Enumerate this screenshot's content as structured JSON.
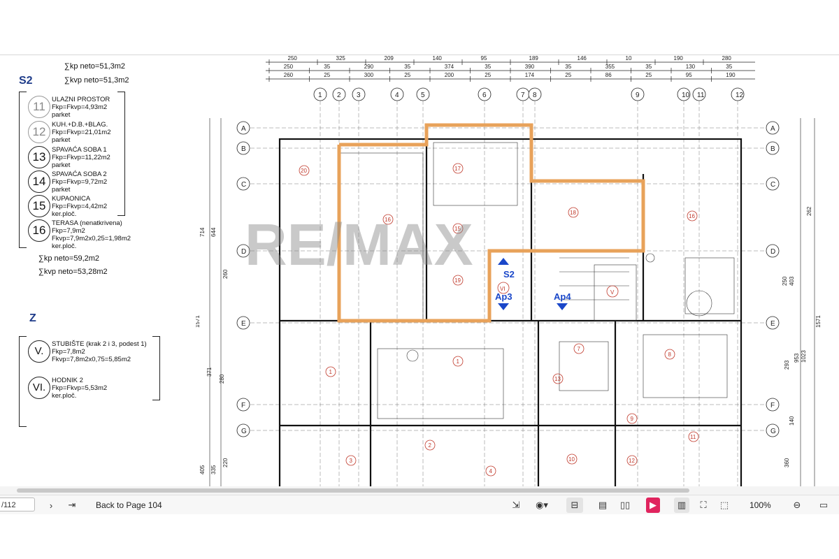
{
  "legend": {
    "sum_top_1": "∑kp neto=51,3m2",
    "sum_top_2": "∑kvp neto=51,3m2",
    "section_s2": "S2",
    "rooms": [
      {
        "num": "11",
        "name": "ULAZNI PROSTOR",
        "area": "Fkp=Fkvp=4,93m2",
        "floor": "parket"
      },
      {
        "num": "12",
        "name": "KUH.+D.B.+BLAG.",
        "area": "Fkp=Fkvp=21,01m2",
        "floor": "parket"
      },
      {
        "num": "13",
        "name": "SPAVAĆA SOBA 1",
        "area": "Fkp=Fkvp=11,22m2",
        "floor": "parket"
      },
      {
        "num": "14",
        "name": "SPAVAĆA SOBA 2",
        "area": "Fkp=Fkvp=9,72m2",
        "floor": "parket"
      },
      {
        "num": "15",
        "name": "KUPAONICA",
        "area": "Fkp=Fkvp=4,42m2",
        "floor": "ker.ploč."
      },
      {
        "num": "16",
        "name": "TERASA  (nenatkrivena)",
        "area": "Fkp=7,9m2",
        "floor": "Fkvp=7,9m2x0,25=1,98m2"
      }
    ],
    "room16_floor2": "ker.ploč.",
    "sum_mid_1": "∑kp neto=59,2m2",
    "sum_mid_2": "∑kvp neto=53,28m2",
    "section_z": "Z",
    "z_rooms": [
      {
        "num": "V.",
        "name": "STUBIŠTE (krak 2 i 3, podest 1)",
        "area": "Fkp=7,8m2",
        "floor": "Fkvp=7,8m2x0,75=5,85m2"
      },
      {
        "num": "VI.",
        "name": "HODNIK 2",
        "area": "Fkp=Fkvp=5,53m2",
        "floor": "ker.ploč."
      }
    ]
  },
  "plan": {
    "dims_row1": [
      "250",
      "325",
      "209",
      "140",
      "95",
      "189",
      "146",
      "10",
      "190",
      "280"
    ],
    "dims_row2": [
      "250",
      "35",
      "290",
      "35",
      "374",
      "35",
      "390",
      "35",
      "355",
      "35",
      "130",
      "35"
    ],
    "dims_row3": [
      "260",
      "25",
      "300",
      "25",
      "200",
      "25",
      "174",
      "25",
      "86",
      "25",
      "95",
      "190"
    ],
    "axis_cols": [
      "1",
      "2",
      "3",
      "4",
      "5",
      "6",
      "7",
      "8",
      "9",
      "10",
      "11",
      "12"
    ],
    "axis_rows": [
      "A",
      "B",
      "C",
      "D",
      "E",
      "F",
      "G"
    ],
    "labels": {
      "s2": "S2",
      "ap3": "Ap3",
      "ap4": "Ap4",
      "watermark": "RE/MAX",
      "vi": "VI",
      "v": "V"
    },
    "left_dims": [
      "714",
      "644",
      "260",
      "1571",
      "371",
      "280",
      "405",
      "335",
      "220"
    ],
    "right_dims": [
      "1571",
      "1023",
      "953",
      "403",
      "262",
      "250",
      "293",
      "140",
      "360"
    ]
  },
  "toolbar": {
    "page_input": "/112",
    "back_label": "Back to Page 104",
    "zoom": "100%"
  },
  "colors": {
    "accent_orange": "#e8a25a",
    "label_blue": "#1f3c8a",
    "room_red": "#c0392b",
    "arrow_blue": "#1a47c9"
  }
}
